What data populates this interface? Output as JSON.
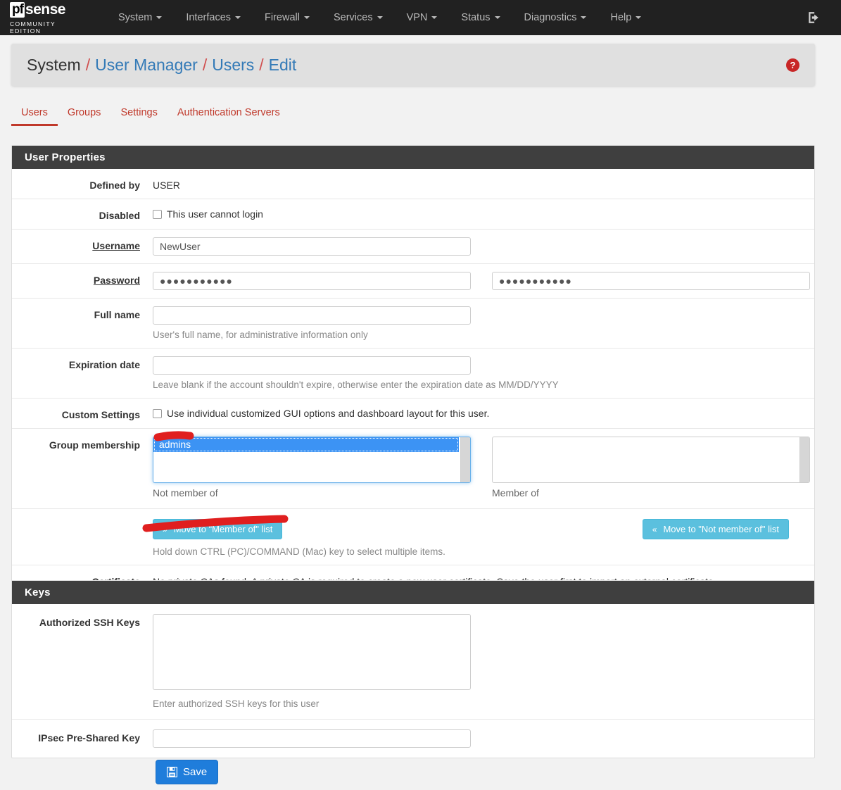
{
  "brand": {
    "logo_pf": "pf",
    "logo_rest": "sense",
    "edition": "COMMUNITY EDITION"
  },
  "navbar": {
    "items": [
      {
        "label": "System",
        "has_caret": true
      },
      {
        "label": "Interfaces",
        "has_caret": true
      },
      {
        "label": "Firewall",
        "has_caret": true
      },
      {
        "label": "Services",
        "has_caret": true
      },
      {
        "label": "VPN",
        "has_caret": true
      },
      {
        "label": "Status",
        "has_caret": true
      },
      {
        "label": "Diagnostics",
        "has_caret": true
      },
      {
        "label": "Help",
        "has_caret": true
      }
    ],
    "logout_icon": "logout-icon"
  },
  "breadcrumb": {
    "root": "System",
    "sep": "/",
    "links": [
      "User Manager",
      "Users",
      "Edit"
    ],
    "help_icon": "help-icon",
    "help_glyph": "?"
  },
  "tabs": [
    {
      "label": "Users",
      "active": true
    },
    {
      "label": "Groups",
      "active": false
    },
    {
      "label": "Settings",
      "active": false
    },
    {
      "label": "Authentication Servers",
      "active": false
    }
  ],
  "user_properties": {
    "heading": "User Properties",
    "defined_by": {
      "label": "Defined by",
      "value": "USER"
    },
    "disabled": {
      "label": "Disabled",
      "checkbox_label": "This user cannot login",
      "checked": false
    },
    "username": {
      "label": "Username",
      "value": "NewUser",
      "required": true
    },
    "password": {
      "label": "Password",
      "required": true,
      "value": "●●●●●●●●●●●",
      "confirm_value": "●●●●●●●●●●●"
    },
    "full_name": {
      "label": "Full name",
      "value": "",
      "help": "User's full name, for administrative information only"
    },
    "expiration_date": {
      "label": "Expiration date",
      "value": "",
      "help": "Leave blank if the account shouldn't expire, otherwise enter the expiration date as MM/DD/YYYY"
    },
    "custom_settings": {
      "label": "Custom Settings",
      "checkbox_label": "Use individual customized GUI options and dashboard layout for this user.",
      "checked": false
    },
    "group_membership": {
      "label": "Group membership",
      "not_member_options": [
        "admins"
      ],
      "not_member_selected": "admins",
      "not_member_caption": "Not member of",
      "member_options": [],
      "member_caption": "Member of"
    },
    "move_buttons": {
      "to_member_label": "Move to \"Member of\" list",
      "to_member_icon": "chevron-double-right-icon",
      "to_member_glyph": "»",
      "to_not_member_label": "Move to \"Not member of\" list",
      "to_not_member_icon": "chevron-double-left-icon",
      "to_not_member_glyph": "«",
      "help": "Hold down CTRL (PC)/COMMAND (Mac) key to select multiple items."
    },
    "certificate": {
      "label": "Certificate",
      "value": "No private CAs found. A private CA is required to create a new user certificate. Save the user first to import an external certificate."
    }
  },
  "keys": {
    "heading": "Keys",
    "authorized_ssh_keys": {
      "label": "Authorized SSH Keys",
      "value": "",
      "help": "Enter authorized SSH keys for this user"
    },
    "ipsec_psk": {
      "label": "IPsec Pre-Shared Key",
      "value": ""
    }
  },
  "actions": {
    "save_label": "Save",
    "save_icon": "save-floppy-icon"
  },
  "annotations": [
    {
      "name": "highlight-stroke-admins",
      "color": "#e01f1f"
    },
    {
      "name": "highlight-stroke-move-button",
      "color": "#e01f1f"
    }
  ],
  "colors": {
    "navbar_bg": "#212121",
    "accent_red": "#c0392b",
    "link_blue": "#337ab7",
    "info_blue": "#5bc0de",
    "primary_blue": "#1f7ddb",
    "select_highlight": "#3c93f4",
    "panel_heading": "#3f3f3f",
    "annotation_red": "#e01f1f"
  }
}
